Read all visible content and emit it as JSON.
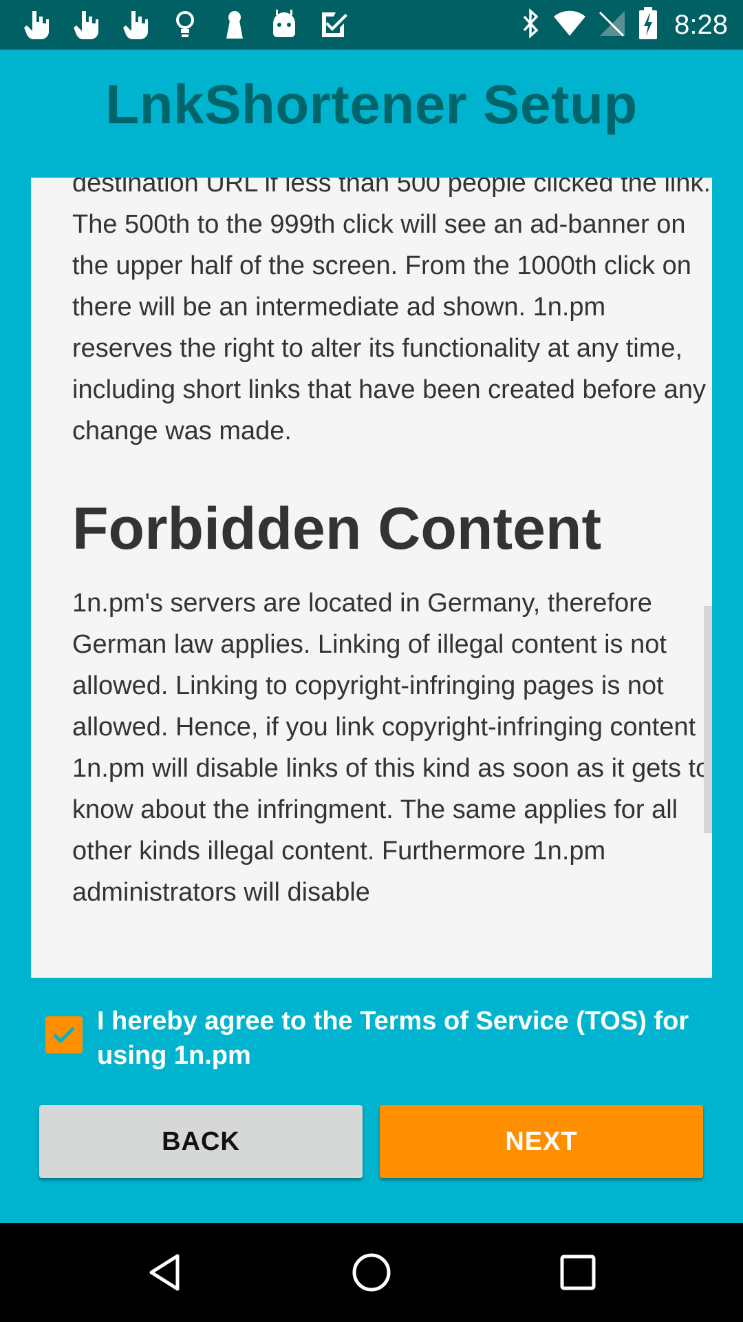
{
  "status_bar": {
    "time": "8:28",
    "left_icons": [
      "hand-pointer-icon",
      "hand-pointer-icon",
      "hand-pointer-icon",
      "lightbulb-icon",
      "keyhole-icon",
      "android-icon",
      "checklist-icon"
    ],
    "right_icons": [
      "bluetooth-icon",
      "wifi-icon",
      "no-signal-icon",
      "battery-charging-icon"
    ]
  },
  "header": {
    "title": "LnkShortener Setup"
  },
  "tos": {
    "paragraph1": "destination URL if less than 500 people clicked the link. The 500th to the 999th click will see an ad-banner on the upper half of the screen. From the 1000th click on there will be an intermediate ad shown. 1n.pm reserves the right to alter its functionality at any time, including short links that have been created before any change was made.",
    "heading": "Forbidden Content",
    "paragraph2": "1n.pm's servers are located in Germany, therefore German law applies. Linking of illegal content is not allowed. Linking to copyright-infringing pages is not allowed. Hence, if you link copyright-infringing content 1n.pm will disable links of this kind as soon as it gets to know about the infringment. The same applies for all other kinds illegal content. Furthermore 1n.pm administrators will disable"
  },
  "agreement": {
    "checked": true,
    "label": "I hereby agree to the Terms of Service (TOS) for using 1n.pm"
  },
  "buttons": {
    "back": "BACK",
    "next": "NEXT"
  },
  "colors": {
    "background": "#00b4cf",
    "status_bar": "#006064",
    "title": "#00646b",
    "accent": "#ff8f00",
    "panel": "#f5f5f5"
  },
  "nav_bar": {
    "icons": [
      "back-triangle-icon",
      "home-circle-icon",
      "recents-square-icon"
    ]
  }
}
